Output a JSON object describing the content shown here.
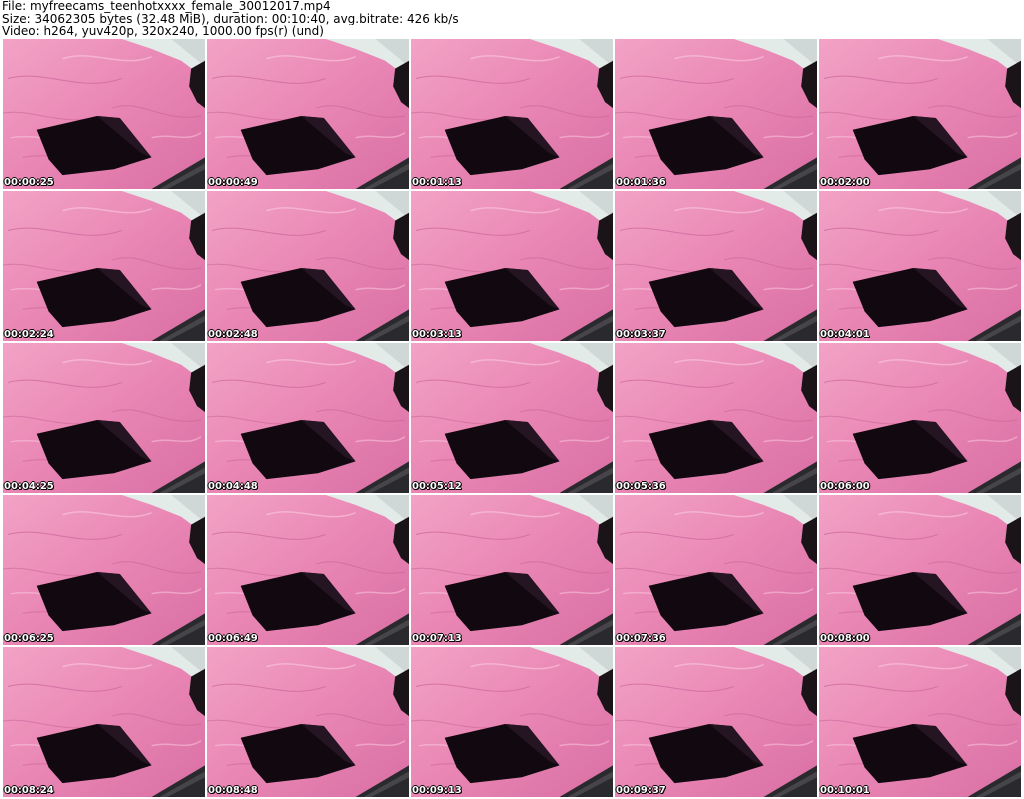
{
  "header": {
    "file_line": "File: myfreecams_teenhotxxxx_female_30012017.mp4",
    "size_line": "Size: 34062305 bytes (32.48 MiB), duration: 00:10:40, avg.bitrate: 426 kb/s",
    "video_line": "Video: h264, yuv420p, 320x240, 1000.00 fps(r) (und)"
  },
  "thumbnails": [
    {
      "timestamp": "00:00:25"
    },
    {
      "timestamp": "00:00:49"
    },
    {
      "timestamp": "00:01:13"
    },
    {
      "timestamp": "00:01:36"
    },
    {
      "timestamp": "00:02:00"
    },
    {
      "timestamp": "00:02:24"
    },
    {
      "timestamp": "00:02:48"
    },
    {
      "timestamp": "00:03:13"
    },
    {
      "timestamp": "00:03:37"
    },
    {
      "timestamp": "00:04:01"
    },
    {
      "timestamp": "00:04:25"
    },
    {
      "timestamp": "00:04:48"
    },
    {
      "timestamp": "00:05:12"
    },
    {
      "timestamp": "00:05:36"
    },
    {
      "timestamp": "00:06:00"
    },
    {
      "timestamp": "00:06:25"
    },
    {
      "timestamp": "00:06:49"
    },
    {
      "timestamp": "00:07:13"
    },
    {
      "timestamp": "00:07:36"
    },
    {
      "timestamp": "00:08:00"
    },
    {
      "timestamp": "00:08:24"
    },
    {
      "timestamp": "00:08:48"
    },
    {
      "timestamp": "00:09:13"
    },
    {
      "timestamp": "00:09:37"
    },
    {
      "timestamp": "00:10:01"
    }
  ],
  "colors": {
    "sheet": "#e87fb0",
    "sheet_light": "#f4a6c8",
    "sheet_dark": "#c9609a",
    "pillow": "#120810",
    "wall": "#dfe6e4"
  }
}
